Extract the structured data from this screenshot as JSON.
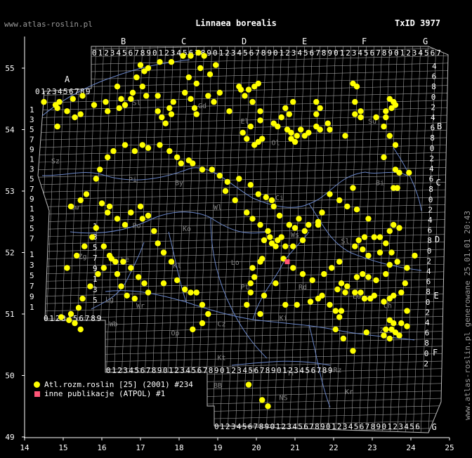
{
  "header": {
    "site": "www.atlas-roslin.pl",
    "title": "Linnaea borealis",
    "txid": "TxID 3977"
  },
  "side_note": "www.atlas-roslin.pl generowane 25.01.01 20:43",
  "legend": {
    "items": [
      {
        "label": "Atl.rozm.roslin [25] (2001) #234",
        "symbol": "yellow-dot"
      },
      {
        "label": "inne publikacje (ATPOL) #1",
        "symbol": "pink-square"
      }
    ]
  },
  "colors": {
    "background": "#000000",
    "grid": "#9a9a9a",
    "border": "#6a86c8",
    "dot": "#ffff00",
    "other": "#ff5577"
  },
  "axes": {
    "x_ticks": [
      "14",
      "15",
      "16",
      "17",
      "18",
      "19",
      "20",
      "21",
      "22",
      "23",
      "24",
      "25"
    ],
    "y_ticks": [
      "49",
      "50",
      "51",
      "52",
      "53",
      "54",
      "55"
    ]
  },
  "grid_letters": {
    "top": [
      "A",
      "B",
      "C",
      "D",
      "E",
      "F",
      "G"
    ],
    "right": [
      "B",
      "C",
      "D",
      "E",
      "F",
      "G"
    ]
  },
  "grid_digits": {
    "top_row": "0123456789012345678901234567890123456789012345678901234567",
    "bottom_row": "0123456789012345678901234567890123456789",
    "left_col": [
      "1",
      "3",
      "5",
      "7",
      "9",
      "1",
      "3",
      "5",
      "7",
      "9",
      "1",
      "3",
      "5",
      "7",
      "9",
      "1",
      "3",
      "5",
      "7",
      "9",
      "1",
      "3",
      "5",
      "7",
      "9",
      "1",
      "3",
      "5",
      "7",
      "9"
    ],
    "right_col": [
      "4",
      "6",
      "8",
      "0",
      "2",
      "4",
      "6",
      "8",
      "0",
      "2",
      "4",
      "6",
      "8",
      "0",
      "2",
      "4",
      "6",
      "8",
      "0",
      "2",
      "4",
      "6",
      "8",
      "0",
      "2",
      "4",
      "6",
      "8",
      "0",
      "2"
    ]
  },
  "regions": [
    {
      "code": "Gd",
      "lon": 18.6,
      "lat": 54.35
    },
    {
      "code": "El",
      "lon": 19.7,
      "lat": 54.1
    },
    {
      "code": "Ol",
      "lon": 20.5,
      "lat": 53.75
    },
    {
      "code": "Su",
      "lon": 23.0,
      "lat": 54.1
    },
    {
      "code": "Bi",
      "lon": 23.2,
      "lat": 53.1
    },
    {
      "code": "Ci",
      "lon": 20.6,
      "lat": 52.85
    },
    {
      "code": "Ws",
      "lon": 21.0,
      "lat": 52.25
    },
    {
      "code": "Sl",
      "lon": 22.3,
      "lat": 52.15
    },
    {
      "code": "Lu",
      "lon": 22.6,
      "lat": 51.25
    },
    {
      "code": "Rd",
      "lon": 21.2,
      "lat": 51.4
    },
    {
      "code": "Ki",
      "lon": 20.7,
      "lat": 50.9
    },
    {
      "code": "Kt",
      "lon": 19.1,
      "lat": 50.25
    },
    {
      "code": "Tr",
      "lon": 20.9,
      "lat": 50.0
    },
    {
      "code": "NS",
      "lon": 20.7,
      "lat": 49.6
    },
    {
      "code": "Kr",
      "lon": 19.9,
      "lat": 50.05
    },
    {
      "code": "BB",
      "lon": 19.0,
      "lat": 49.8
    },
    {
      "code": "Pi",
      "lon": 16.8,
      "lat": 53.15
    },
    {
      "code": "By",
      "lon": 18.0,
      "lat": 53.1
    },
    {
      "code": "Wl",
      "lon": 19.0,
      "lat": 52.7
    },
    {
      "code": "Ko",
      "lon": 18.2,
      "lat": 52.35
    },
    {
      "code": "Po",
      "lon": 16.9,
      "lat": 52.4
    },
    {
      "code": "Le",
      "lon": 16.6,
      "lat": 51.85
    },
    {
      "code": "Kl",
      "lon": 17.95,
      "lat": 51.75
    },
    {
      "code": "Lo",
      "lon": 19.45,
      "lat": 51.8
    },
    {
      "code": "Pt",
      "lon": 19.7,
      "lat": 51.4
    },
    {
      "code": "Zg",
      "lon": 15.5,
      "lat": 51.9
    },
    {
      "code": "Lg",
      "lon": 16.2,
      "lat": 51.2
    },
    {
      "code": "Wr",
      "lon": 17.0,
      "lat": 51.1
    },
    {
      "code": "Wb",
      "lon": 16.3,
      "lat": 50.8
    },
    {
      "code": "Op",
      "lon": 17.9,
      "lat": 50.65
    },
    {
      "code": "Cz",
      "lon": 19.1,
      "lat": 50.8
    },
    {
      "code": "Gw",
      "lon": 15.3,
      "lat": 52.7
    },
    {
      "code": "Sz",
      "lon": 14.8,
      "lat": 53.45
    },
    {
      "code": "Sl",
      "lon": 16.9,
      "lat": 54.4
    },
    {
      "code": "Ch",
      "lon": 23.4,
      "lat": 51.1
    },
    {
      "code": "Zm",
      "lon": 23.3,
      "lat": 50.7
    },
    {
      "code": "Rz",
      "lon": 22.1,
      "lat": 50.05
    },
    {
      "code": "Kr",
      "lon": 22.4,
      "lat": 49.7
    }
  ],
  "records": [
    [
      14.5,
      54.45
    ],
    [
      14.8,
      54.4
    ],
    [
      14.9,
      54.45
    ],
    [
      14.85,
      54.35
    ],
    [
      15.1,
      54.3
    ],
    [
      15.25,
      54.5
    ],
    [
      15.5,
      54.55
    ],
    [
      15.45,
      54.25
    ],
    [
      15.3,
      54.2
    ],
    [
      14.85,
      54.05
    ],
    [
      15.8,
      54.4
    ],
    [
      16.1,
      54.45
    ],
    [
      16.15,
      54.3
    ],
    [
      16.4,
      54.7
    ],
    [
      16.5,
      54.5
    ],
    [
      16.45,
      54.35
    ],
    [
      16.6,
      54.4
    ],
    [
      16.8,
      54.6
    ],
    [
      16.75,
      54.5
    ],
    [
      16.9,
      54.85
    ],
    [
      17.0,
      55.05
    ],
    [
      17.1,
      54.95
    ],
    [
      17.2,
      55.0
    ],
    [
      17.05,
      54.7
    ],
    [
      17.15,
      54.55
    ],
    [
      17.45,
      54.55
    ],
    [
      17.45,
      54.3
    ],
    [
      17.5,
      55.1
    ],
    [
      17.8,
      55.1
    ],
    [
      18.1,
      55.2
    ],
    [
      18.3,
      55.2
    ],
    [
      18.5,
      55.25
    ],
    [
      18.65,
      55.2
    ],
    [
      18.55,
      55.0
    ],
    [
      18.8,
      54.9
    ],
    [
      18.95,
      55.05
    ],
    [
      18.25,
      54.85
    ],
    [
      18.45,
      54.75
    ],
    [
      18.15,
      54.6
    ],
    [
      17.85,
      54.45
    ],
    [
      17.75,
      54.35
    ],
    [
      17.8,
      54.25
    ],
    [
      17.55,
      54.2
    ],
    [
      17.65,
      54.1
    ],
    [
      18.3,
      54.5
    ],
    [
      18.4,
      54.35
    ],
    [
      18.45,
      54.25
    ],
    [
      18.75,
      54.55
    ],
    [
      18.9,
      54.45
    ],
    [
      19.05,
      54.6
    ],
    [
      19.3,
      54.3
    ],
    [
      19.55,
      54.7
    ],
    [
      19.6,
      54.65
    ],
    [
      19.8,
      54.65
    ],
    [
      19.95,
      54.7
    ],
    [
      20.05,
      54.75
    ],
    [
      19.7,
      54.55
    ],
    [
      19.9,
      54.45
    ],
    [
      20.1,
      54.3
    ],
    [
      20.1,
      54.15
    ],
    [
      19.85,
      54.05
    ],
    [
      19.75,
      53.85
    ],
    [
      19.65,
      53.95
    ],
    [
      19.95,
      53.75
    ],
    [
      20.05,
      53.8
    ],
    [
      20.15,
      53.85
    ],
    [
      20.45,
      54.1
    ],
    [
      20.55,
      54.05
    ],
    [
      20.65,
      54.2
    ],
    [
      20.75,
      54.35
    ],
    [
      20.85,
      54.25
    ],
    [
      20.95,
      54.45
    ],
    [
      20.8,
      54.0
    ],
    [
      20.9,
      53.95
    ],
    [
      21.05,
      53.9
    ],
    [
      20.9,
      53.85
    ],
    [
      21.0,
      53.8
    ],
    [
      21.15,
      54.0
    ],
    [
      21.25,
      53.9
    ],
    [
      21.35,
      53.95
    ],
    [
      21.55,
      54.05
    ],
    [
      21.65,
      54.0
    ],
    [
      21.55,
      54.25
    ],
    [
      21.65,
      54.35
    ],
    [
      21.55,
      54.45
    ],
    [
      21.85,
      54.1
    ],
    [
      21.9,
      54.0
    ],
    [
      22.3,
      53.9
    ],
    [
      22.5,
      54.75
    ],
    [
      22.6,
      54.7
    ],
    [
      22.55,
      54.45
    ],
    [
      22.7,
      54.3
    ],
    [
      22.55,
      54.25
    ],
    [
      22.7,
      54.2
    ],
    [
      23.1,
      54.2
    ],
    [
      23.35,
      54.3
    ],
    [
      23.5,
      54.35
    ],
    [
      23.55,
      54.45
    ],
    [
      23.45,
      54.5
    ],
    [
      23.6,
      54.4
    ],
    [
      23.35,
      54.2
    ],
    [
      23.3,
      54.05
    ],
    [
      23.45,
      53.9
    ],
    [
      23.6,
      53.75
    ],
    [
      23.3,
      53.55
    ],
    [
      23.6,
      53.35
    ],
    [
      23.7,
      53.3
    ],
    [
      23.95,
      53.3
    ],
    [
      23.55,
      53.05
    ],
    [
      23.65,
      53.05
    ],
    [
      22.5,
      53.05
    ],
    [
      21.9,
      52.95
    ],
    [
      21.6,
      52.45
    ],
    [
      21.25,
      52.35
    ],
    [
      21.2,
      52.2
    ],
    [
      20.95,
      52.1
    ],
    [
      20.75,
      52.1
    ],
    [
      20.65,
      52.25
    ],
    [
      20.5,
      52.1
    ],
    [
      20.4,
      52.15
    ],
    [
      20.35,
      52.25
    ],
    [
      20.2,
      52.2
    ],
    [
      20.15,
      51.9
    ],
    [
      20.1,
      51.85
    ],
    [
      19.9,
      51.75
    ],
    [
      19.95,
      51.6
    ],
    [
      19.85,
      51.5
    ],
    [
      19.85,
      51.35
    ],
    [
      19.75,
      51.15
    ],
    [
      20.1,
      51.0
    ],
    [
      20.2,
      51.3
    ],
    [
      20.5,
      51.5
    ],
    [
      20.75,
      51.15
    ],
    [
      21.05,
      51.15
    ],
    [
      21.4,
      51.2
    ],
    [
      21.6,
      51.25
    ],
    [
      21.7,
      51.3
    ],
    [
      21.9,
      51.15
    ],
    [
      22.05,
      51.05
    ],
    [
      22.1,
      51.4
    ],
    [
      22.2,
      51.5
    ],
    [
      22.35,
      51.45
    ],
    [
      22.55,
      51.35
    ],
    [
      22.7,
      51.35
    ],
    [
      22.8,
      51.25
    ],
    [
      22.95,
      51.25
    ],
    [
      23.05,
      51.3
    ],
    [
      23.3,
      51.2
    ],
    [
      23.45,
      51.25
    ],
    [
      23.55,
      51.3
    ],
    [
      23.75,
      51.35
    ],
    [
      23.85,
      51.5
    ],
    [
      23.9,
      51.05
    ],
    [
      23.45,
      50.9
    ],
    [
      23.55,
      50.85
    ],
    [
      23.75,
      50.85
    ],
    [
      23.9,
      50.8
    ],
    [
      23.35,
      50.75
    ],
    [
      23.5,
      50.75
    ],
    [
      23.6,
      50.7
    ],
    [
      23.3,
      50.65
    ],
    [
      23.45,
      50.6
    ],
    [
      23.7,
      50.65
    ],
    [
      22.85,
      50.7
    ],
    [
      22.5,
      50.4
    ],
    [
      22.25,
      50.6
    ],
    [
      22.05,
      50.75
    ],
    [
      22.15,
      50.95
    ],
    [
      22.2,
      51.05
    ],
    [
      22.3,
      51.35
    ],
    [
      22.6,
      51.6
    ],
    [
      22.75,
      51.65
    ],
    [
      22.9,
      51.6
    ],
    [
      23.1,
      51.55
    ],
    [
      23.35,
      51.65
    ],
    [
      23.45,
      51.8
    ],
    [
      23.65,
      51.85
    ],
    [
      23.9,
      51.75
    ],
    [
      24.1,
      51.95
    ],
    [
      23.35,
      52.15
    ],
    [
      23.45,
      52.35
    ],
    [
      23.55,
      52.45
    ],
    [
      23.7,
      52.4
    ],
    [
      23.2,
      52.25
    ],
    [
      23.05,
      52.25
    ],
    [
      22.8,
      52.25
    ],
    [
      22.65,
      52.2
    ],
    [
      22.55,
      52.1
    ],
    [
      22.75,
      52.05
    ],
    [
      22.9,
      51.95
    ],
    [
      23.2,
      52.0
    ],
    [
      23.5,
      52.0
    ],
    [
      22.9,
      52.55
    ],
    [
      22.6,
      52.7
    ],
    [
      22.35,
      52.75
    ],
    [
      22.15,
      52.85
    ],
    [
      21.7,
      52.65
    ],
    [
      21.6,
      52.5
    ],
    [
      21.35,
      52.45
    ],
    [
      21.1,
      52.55
    ],
    [
      21.0,
      52.4
    ],
    [
      20.85,
      52.45
    ],
    [
      20.6,
      52.6
    ],
    [
      20.45,
      52.75
    ],
    [
      20.4,
      52.85
    ],
    [
      20.25,
      52.9
    ],
    [
      20.05,
      52.95
    ],
    [
      19.85,
      53.1
    ],
    [
      19.55,
      53.2
    ],
    [
      19.25,
      53.15
    ],
    [
      19.05,
      53.25
    ],
    [
      18.85,
      53.35
    ],
    [
      18.6,
      53.35
    ],
    [
      18.35,
      53.45
    ],
    [
      18.25,
      53.5
    ],
    [
      18.05,
      53.45
    ],
    [
      17.95,
      53.55
    ],
    [
      17.75,
      53.65
    ],
    [
      17.5,
      53.75
    ],
    [
      17.2,
      53.7
    ],
    [
      17.05,
      53.75
    ],
    [
      16.85,
      53.65
    ],
    [
      16.6,
      53.75
    ],
    [
      16.3,
      53.65
    ],
    [
      16.15,
      53.55
    ],
    [
      15.95,
      53.35
    ],
    [
      15.85,
      53.2
    ],
    [
      15.6,
      52.95
    ],
    [
      15.45,
      52.85
    ],
    [
      15.2,
      52.75
    ],
    [
      16.15,
      52.65
    ],
    [
      16.2,
      52.75
    ],
    [
      16.0,
      52.8
    ],
    [
      16.4,
      52.55
    ],
    [
      16.6,
      52.45
    ],
    [
      16.75,
      52.65
    ],
    [
      17.0,
      52.75
    ],
    [
      17.2,
      52.6
    ],
    [
      17.05,
      52.55
    ],
    [
      17.35,
      52.35
    ],
    [
      17.45,
      52.15
    ],
    [
      17.6,
      52.0
    ],
    [
      17.8,
      51.85
    ],
    [
      17.95,
      51.55
    ],
    [
      18.15,
      51.4
    ],
    [
      18.3,
      51.35
    ],
    [
      18.45,
      51.35
    ],
    [
      18.6,
      51.15
    ],
    [
      18.75,
      51.0
    ],
    [
      18.6,
      50.85
    ],
    [
      18.35,
      50.75
    ],
    [
      17.6,
      51.5
    ],
    [
      17.2,
      51.35
    ],
    [
      17.1,
      51.5
    ],
    [
      16.95,
      51.6
    ],
    [
      16.75,
      51.75
    ],
    [
      16.55,
      51.85
    ],
    [
      16.35,
      51.85
    ],
    [
      16.2,
      51.95
    ],
    [
      16.05,
      51.75
    ],
    [
      15.9,
      51.65
    ],
    [
      15.7,
      51.45
    ],
    [
      15.5,
      51.25
    ],
    [
      15.4,
      51.1
    ],
    [
      15.2,
      51.0
    ],
    [
      14.95,
      50.95
    ],
    [
      15.15,
      50.9
    ],
    [
      15.3,
      50.85
    ],
    [
      15.45,
      50.75
    ],
    [
      15.1,
      51.75
    ],
    [
      15.35,
      51.95
    ],
    [
      15.55,
      52.1
    ],
    [
      15.75,
      52.25
    ],
    [
      15.85,
      52.4
    ],
    [
      16.05,
      52.1
    ],
    [
      16.25,
      51.9
    ],
    [
      16.4,
      51.65
    ],
    [
      16.5,
      51.45
    ],
    [
      16.65,
      51.3
    ],
    [
      16.85,
      51.25
    ],
    [
      19.2,
      53.0
    ],
    [
      19.45,
      52.85
    ],
    [
      19.75,
      52.65
    ],
    [
      19.9,
      52.55
    ],
    [
      20.1,
      52.45
    ],
    [
      20.3,
      52.35
    ],
    [
      20.55,
      52.2
    ],
    [
      20.7,
      51.9
    ],
    [
      20.95,
      51.75
    ],
    [
      21.2,
      51.65
    ],
    [
      21.45,
      51.55
    ],
    [
      21.75,
      51.65
    ],
    [
      21.95,
      51.75
    ],
    [
      22.15,
      51.85
    ],
    [
      19.8,
      49.85
    ],
    [
      20.15,
      49.6
    ],
    [
      20.3,
      49.5
    ]
  ],
  "other_records": [
    [
      20.8,
      51.85
    ]
  ]
}
